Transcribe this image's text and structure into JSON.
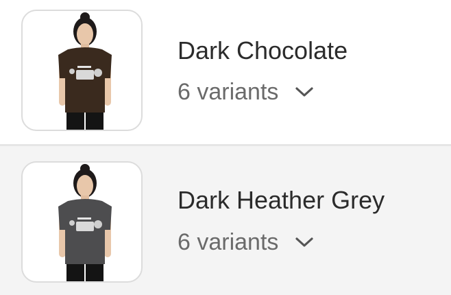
{
  "items": [
    {
      "title": "Dark Chocolate",
      "variants_label": "6 variants",
      "shirt_color": "#3a2a1e",
      "icon": "chevron-down-icon"
    },
    {
      "title": "Dark Heather Grey",
      "variants_label": "6 variants",
      "shirt_color": "#4d4d4f",
      "icon": "chevron-down-icon"
    }
  ]
}
